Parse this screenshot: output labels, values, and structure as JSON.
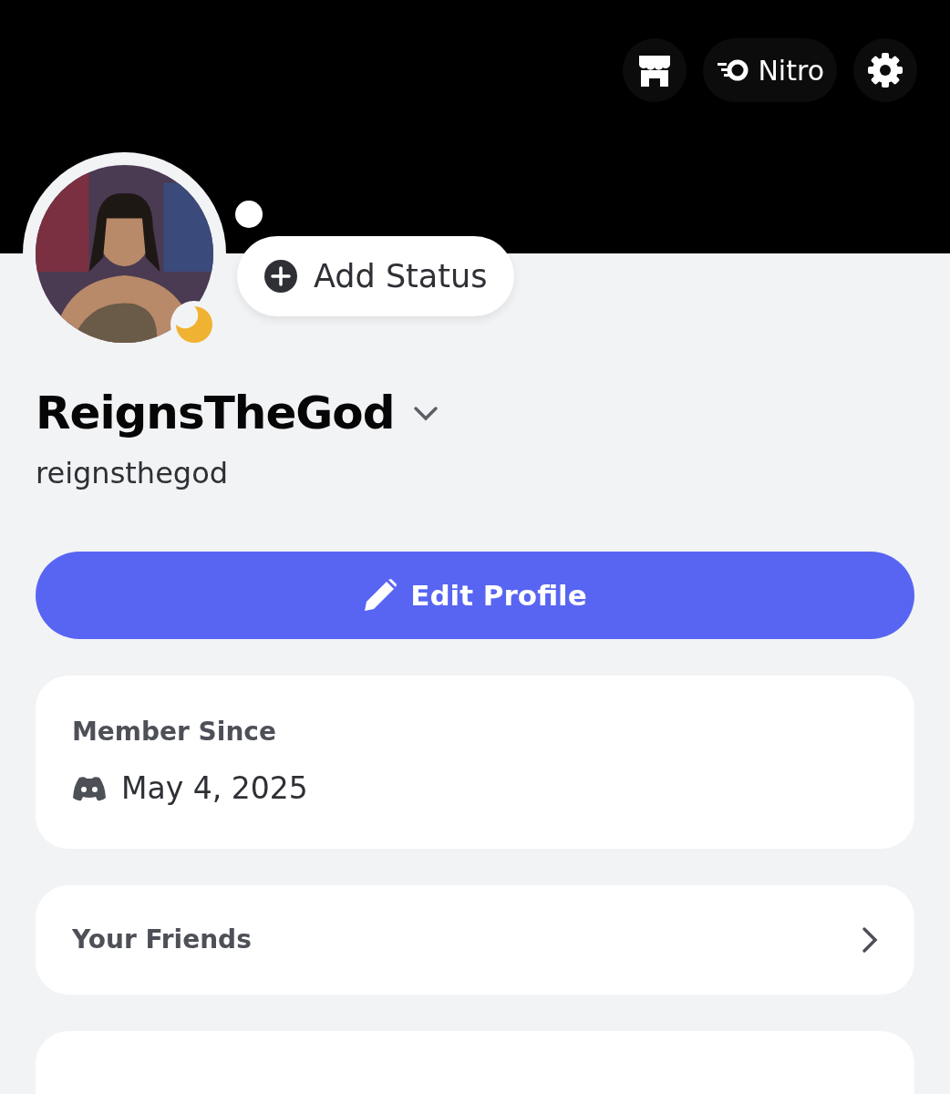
{
  "header": {
    "nitro_label": "Nitro"
  },
  "profile": {
    "idle": true,
    "add_status_label": "Add Status",
    "display_name": "ReignsTheGod",
    "username": "reignsthegod"
  },
  "edit_profile_label": "Edit Profile",
  "member_since": {
    "title": "Member Since",
    "date": "May 4, 2025"
  },
  "friends": {
    "title": "Your Friends"
  }
}
